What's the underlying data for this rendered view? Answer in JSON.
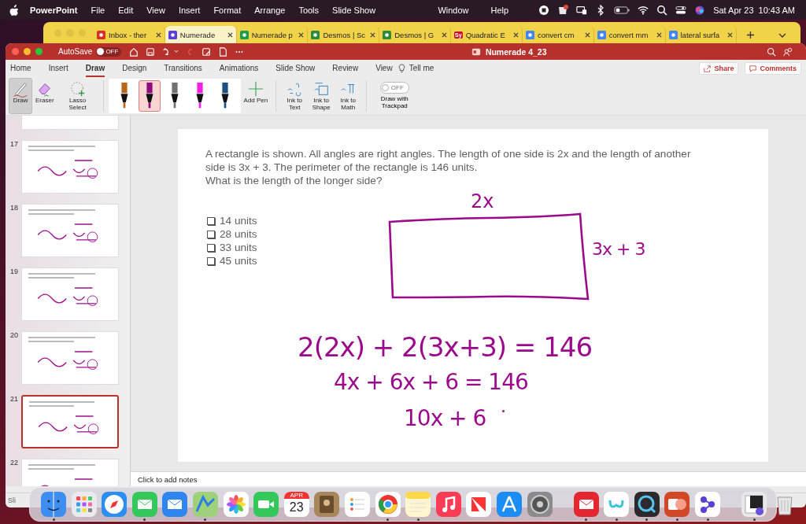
{
  "menu_bar": {
    "app_name": "PowerPoint",
    "items": [
      "File",
      "Edit",
      "View",
      "Insert",
      "Format",
      "Arrange",
      "Tools",
      "Slide Show"
    ],
    "right_items": [
      "Window",
      "Help"
    ],
    "date": "Sat Apr 23",
    "time": "10:43 AM"
  },
  "browser": {
    "tabs": [
      {
        "title": "Inbox - ther",
        "selected": false,
        "color": "#d93025"
      },
      {
        "title": "Numerade",
        "selected": true,
        "color": "#5b3fd6"
      },
      {
        "title": "Numerade p",
        "selected": false,
        "color": "#1e9e4a"
      },
      {
        "title": "Desmos | Sc",
        "selected": false,
        "color": "#2e8b3a"
      },
      {
        "title": "Desmos | G",
        "selected": false,
        "color": "#2e8b3a"
      },
      {
        "title": "Quadratic E",
        "selected": false,
        "color": "#c8102e",
        "favicon_text": "Sy"
      },
      {
        "title": "convert cm",
        "selected": false,
        "color": "#4285f4"
      },
      {
        "title": "convert mm",
        "selected": false,
        "color": "#4285f4"
      },
      {
        "title": "lateral surfa",
        "selected": false,
        "color": "#4285f4"
      }
    ]
  },
  "window": {
    "title": "Numerade 4_23",
    "autosave": {
      "label": "AutoSave",
      "on": false,
      "state_text": "OFF"
    }
  },
  "ribbon_tabs": [
    {
      "label": "Home",
      "selected": false
    },
    {
      "label": "Insert",
      "selected": false
    },
    {
      "label": "Draw",
      "selected": true
    },
    {
      "label": "Design",
      "selected": false
    },
    {
      "label": "Transitions",
      "selected": false
    },
    {
      "label": "Animations",
      "selected": false
    },
    {
      "label": "Slide Show",
      "selected": false
    },
    {
      "label": "Review",
      "selected": false
    },
    {
      "label": "View",
      "selected": false
    }
  ],
  "tell_me": "Tell me",
  "share": "Share",
  "comments": "Comments",
  "ribbon": {
    "tools": [
      {
        "label": "Draw",
        "selected": true
      },
      {
        "label": "Eraser",
        "selected": false
      },
      {
        "label": "Lasso Select",
        "selected": false
      }
    ],
    "pens": [
      {
        "color": "#b8651e",
        "selected": false
      },
      {
        "color": "#8e0a7e",
        "selected": true
      },
      {
        "color": "#6f7274",
        "selected": false
      },
      {
        "color": "#f21ee8",
        "selected": false
      },
      {
        "color": "#1b4f80",
        "selected": false
      }
    ],
    "add_pen": "Add Pen",
    "ink_tools": [
      "Ink to Text",
      "Ink to Shape",
      "Ink to Math"
    ],
    "trackpad": {
      "label": "Draw with Trackpad",
      "on": false,
      "state_text": "OFF"
    }
  },
  "thumbnails": [
    {
      "selected": false
    },
    {
      "number": "17",
      "selected": false
    },
    {
      "number": "18",
      "selected": false
    },
    {
      "number": "19",
      "selected": false
    },
    {
      "number": "20",
      "selected": false
    },
    {
      "number": "21",
      "selected": true
    },
    {
      "number": "22",
      "selected": false
    }
  ],
  "slide": {
    "question": [
      "A rectangle is shown. All angles are right angles. The length of one side is 2x and the length of another side is 3x + 3. The perimeter of the rectangle is 146 units.",
      "What is the length of the longer side?"
    ],
    "options": [
      {
        "label": "14 units",
        "checked": false
      },
      {
        "label": "28 units",
        "checked": false
      },
      {
        "label": "33 units",
        "checked": false
      },
      {
        "label": "45 units",
        "checked": false
      }
    ],
    "ink": {
      "top_label": "2x",
      "side_label": "3x + 3",
      "lines": [
        "2(2x) + 2(3x+3) = 146",
        "4x + 6x + 6 = 146",
        "10x + 6"
      ]
    }
  },
  "notes_placeholder": "Click to add notes",
  "status_text": "Sli",
  "dock": {
    "calendar_month": "APR",
    "calendar_day": "23",
    "items": [
      {
        "running": true
      },
      {
        "running": false
      },
      {
        "running": false
      },
      {
        "running": true
      },
      {
        "running": false
      },
      {
        "running": true
      },
      {
        "running": false
      },
      {
        "running": false
      },
      {
        "running": false
      },
      {
        "running": false
      },
      {
        "running": false
      },
      {
        "running": true
      },
      {
        "running": true
      },
      {
        "running": false
      },
      {
        "running": false
      },
      {
        "running": false
      },
      {
        "running": false
      },
      {
        "running": true
      },
      {
        "running": true
      },
      {
        "running": true
      },
      {
        "running": true
      },
      {
        "running": true
      },
      {
        "running": true
      },
      {
        "running": false
      }
    ]
  }
}
